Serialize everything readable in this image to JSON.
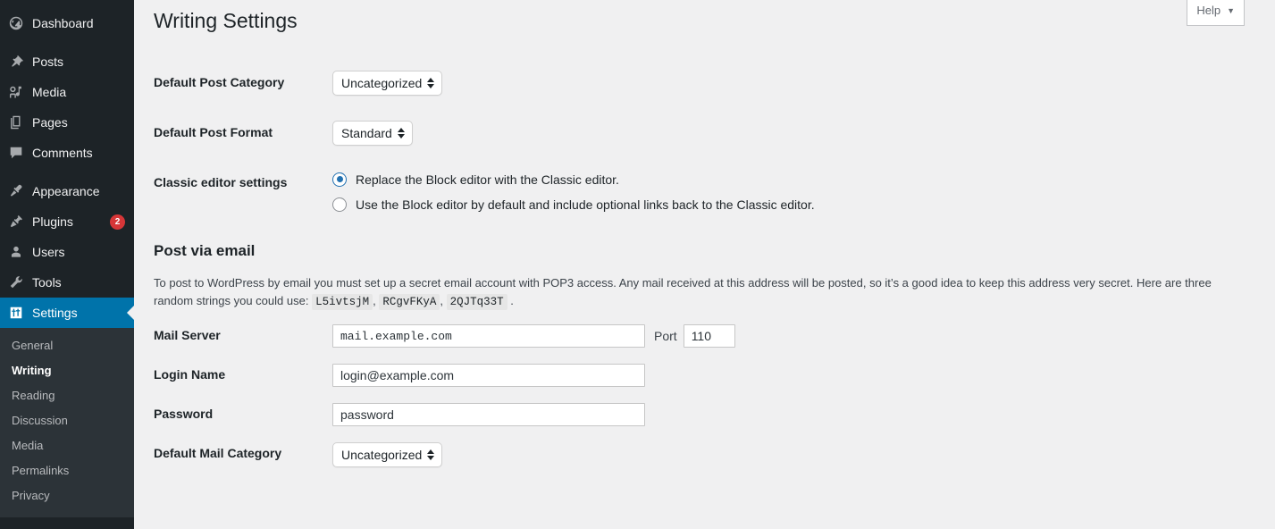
{
  "sidebar": {
    "primary": [
      {
        "label": "Dashboard",
        "icon": "dashboard-icon",
        "name": "sidebar-item-dashboard",
        "current": false,
        "badge": null
      },
      {
        "label": "Posts",
        "icon": "pin-icon",
        "name": "sidebar-item-posts",
        "current": false,
        "badge": null
      },
      {
        "label": "Media",
        "icon": "media-icon",
        "name": "sidebar-item-media",
        "current": false,
        "badge": null
      },
      {
        "label": "Pages",
        "icon": "pages-icon",
        "name": "sidebar-item-pages",
        "current": false,
        "badge": null
      },
      {
        "label": "Comments",
        "icon": "comment-icon",
        "name": "sidebar-item-comments",
        "current": false,
        "badge": null
      },
      {
        "label": "Appearance",
        "icon": "brush-icon",
        "name": "sidebar-item-appearance",
        "current": false,
        "badge": null
      },
      {
        "label": "Plugins",
        "icon": "plug-icon",
        "name": "sidebar-item-plugins",
        "current": false,
        "badge": "2"
      },
      {
        "label": "Users",
        "icon": "user-icon",
        "name": "sidebar-item-users",
        "current": false,
        "badge": null
      },
      {
        "label": "Tools",
        "icon": "wrench-icon",
        "name": "sidebar-item-tools",
        "current": false,
        "badge": null
      },
      {
        "label": "Settings",
        "icon": "settings-sliders-icon",
        "name": "sidebar-item-settings",
        "current": true,
        "badge": null
      }
    ],
    "submenu": [
      {
        "label": "General",
        "name": "submenu-item-general",
        "current": false
      },
      {
        "label": "Writing",
        "name": "submenu-item-writing",
        "current": true
      },
      {
        "label": "Reading",
        "name": "submenu-item-reading",
        "current": false
      },
      {
        "label": "Discussion",
        "name": "submenu-item-discussion",
        "current": false
      },
      {
        "label": "Media",
        "name": "submenu-item-media",
        "current": false
      },
      {
        "label": "Permalinks",
        "name": "submenu-item-permalinks",
        "current": false
      },
      {
        "label": "Privacy",
        "name": "submenu-item-privacy",
        "current": false
      }
    ],
    "colors": {
      "background": "#1d2327",
      "submenu_background": "#2c3338",
      "current_background": "#0073aa",
      "badge_background": "#d63638"
    }
  },
  "help_tab": {
    "label": "Help",
    "caret": "▼"
  },
  "page": {
    "title": "Writing Settings"
  },
  "writing": {
    "default_post_category": {
      "label": "Default Post Category",
      "value": "Uncategorized"
    },
    "default_post_format": {
      "label": "Default Post Format",
      "value": "Standard"
    },
    "classic_editor": {
      "label": "Classic editor settings",
      "options": [
        {
          "text": "Replace the Block editor with the Classic editor.",
          "checked": true
        },
        {
          "text": "Use the Block editor by default and include optional links back to the Classic editor.",
          "checked": false
        }
      ]
    }
  },
  "post_via_email": {
    "heading": "Post via email",
    "description_part1": "To post to WordPress by email you must set up a secret email account with POP3 access. Any mail received at this address will be posted, so it’s a good idea to keep this address very secret. Here are three random strings you could use:",
    "random_strings": [
      "L5ivtsjM",
      "RCgvFKyA",
      "2QJTq33T"
    ],
    "separator": ",",
    "period": ".",
    "fields": {
      "mail_server": {
        "label": "Mail Server",
        "value": "mail.example.com",
        "placeholder": "mail.example.com"
      },
      "port": {
        "label": "Port",
        "value": "110",
        "placeholder": "110"
      },
      "login_name": {
        "label": "Login Name",
        "value": "login@example.com",
        "placeholder": "login@example.com"
      },
      "password": {
        "label": "Password",
        "value": "password",
        "placeholder": "password"
      },
      "default_mail_category": {
        "label": "Default Mail Category",
        "value": "Uncategorized"
      }
    }
  },
  "colors": {
    "body_background": "#f0f0f1",
    "accent": "#2271b1",
    "text": "#1d2327"
  }
}
